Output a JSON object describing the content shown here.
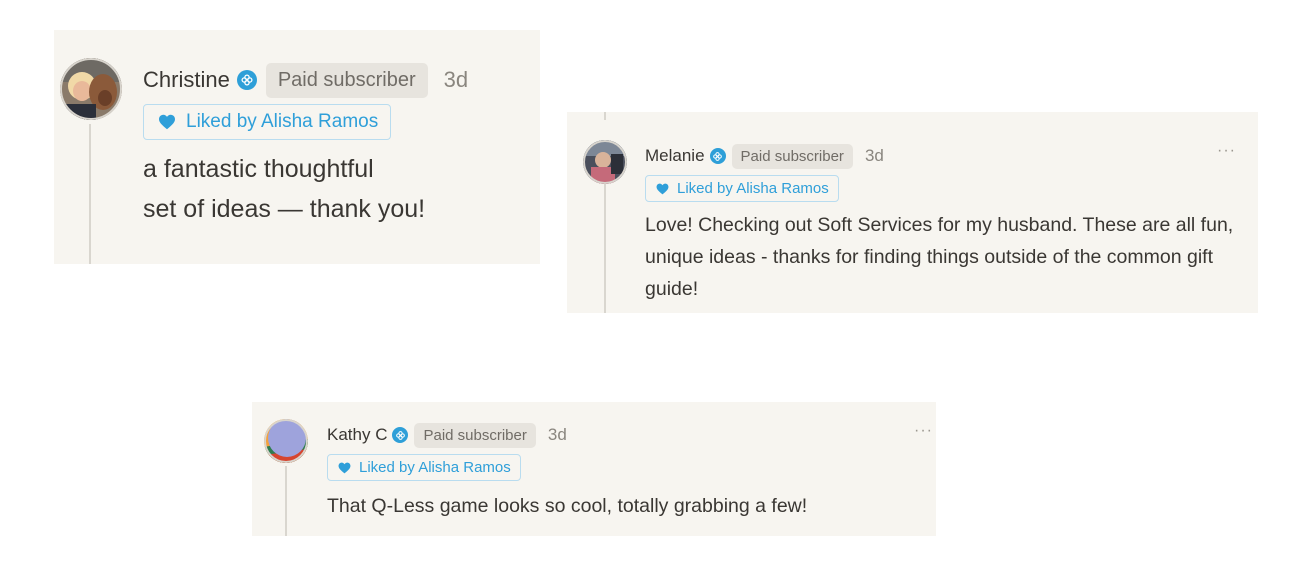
{
  "comments": [
    {
      "author": "Christine",
      "badge_icon": "subscriber-badge-icon",
      "badge": "Paid subscriber",
      "time": "3d",
      "liked_by": "Liked by Alisha Ramos",
      "body_lines": [
        "a fantastic thoughtful",
        "set of ideas — thank you!"
      ],
      "avatar": "photo of woman with dog"
    },
    {
      "author": "Melanie",
      "badge_icon": "subscriber-badge-icon",
      "badge": "Paid subscriber",
      "time": "3d",
      "liked_by": "Liked by Alisha Ramos",
      "body": "Love! Checking out Soft Services for my husband. These are all fun, unique ideas - thanks for finding things outside of the common gift guide!",
      "more": "···",
      "avatar": "photo avatar"
    },
    {
      "author": "Kathy C",
      "badge_icon": "subscriber-badge-icon",
      "badge": "Paid subscriber",
      "time": "3d",
      "liked_by": "Liked by Alisha Ramos",
      "body": "That Q-Less game looks so cool, totally grabbing a few!",
      "more": "···",
      "avatar": "generated gradient avatar"
    }
  ],
  "colors": {
    "card_bg": "#f7f5f0",
    "accent_blue": "#2f9fd9",
    "badge_bg": "#e7e4de",
    "text": "#3a3733"
  }
}
